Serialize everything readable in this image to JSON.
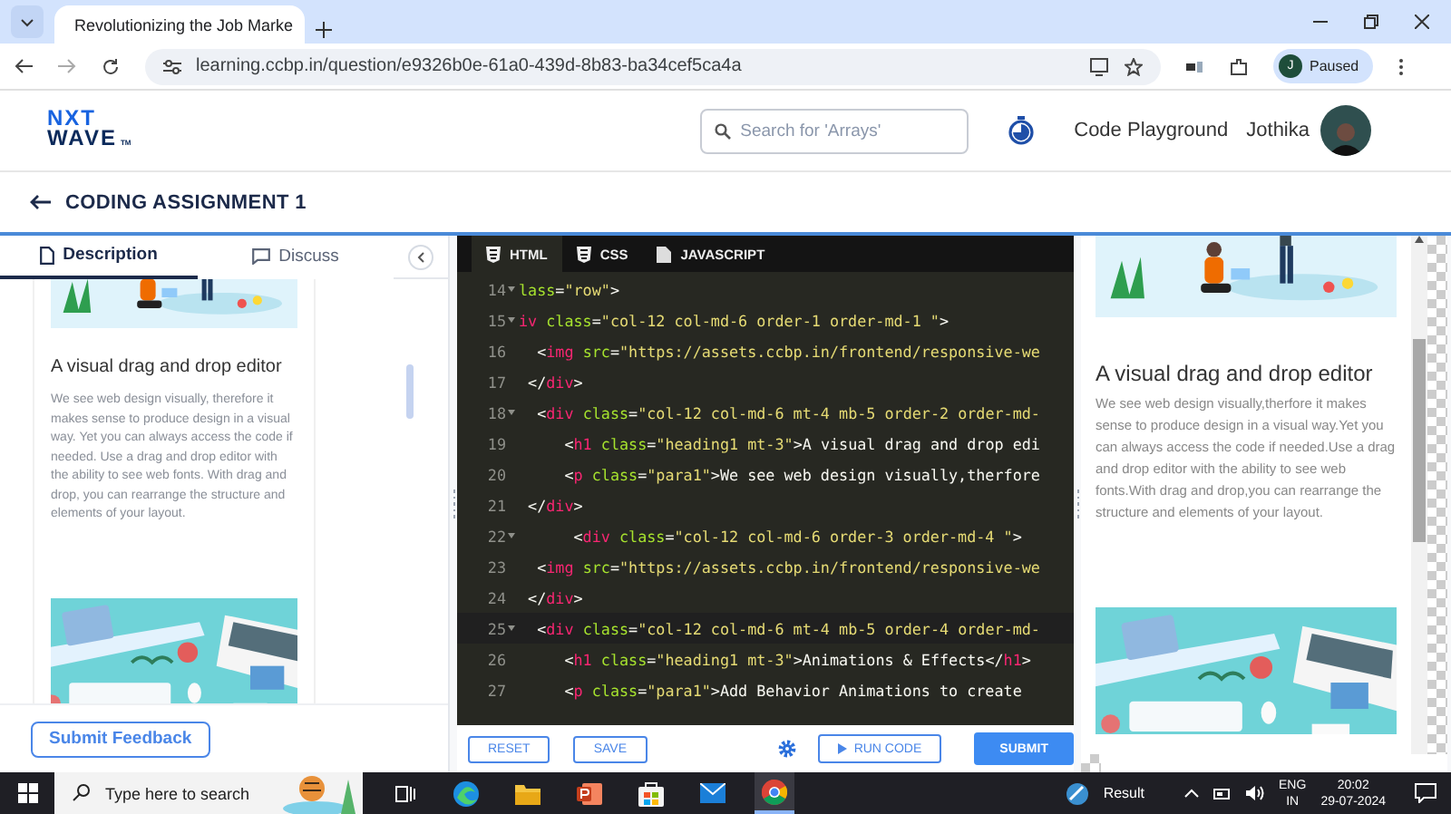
{
  "browser": {
    "tab_title": "Revolutionizing the Job Marke",
    "url": "learning.ccbp.in/question/e9326b0e-61a0-439d-8b83-ba34cef5ca4a",
    "profile_initial": "J",
    "profile_status": "Paused"
  },
  "header": {
    "logo": [
      "NXT",
      "WAVE"
    ],
    "logo_mark": "TM",
    "search": {
      "placeholder": "Search for 'Arrays'"
    },
    "nav": "Code Playground",
    "user": "Jothika"
  },
  "assignment": {
    "title": "CODING ASSIGNMENT 1"
  },
  "description": {
    "tabs": [
      {
        "label": "Description",
        "selected": true
      },
      {
        "label": "Discuss",
        "selected": false
      }
    ],
    "content": [
      {
        "kind": "picture"
      },
      {
        "kind": "heading",
        "text": "A visual drag and drop editor"
      },
      {
        "kind": "paragraph",
        "text": "We see web design visually, therefore it makes sense to produce design in a visual way. Yet you can always access the code if needed. Use a drag and drop editor with the ability to see web fonts. With drag and drop, you can rearrange the structure and elements of your layout."
      },
      {
        "kind": "picture"
      }
    ],
    "feedback_button": "Submit Feedback"
  },
  "editor": {
    "tabs": [
      {
        "label": "HTML",
        "selected": true
      },
      {
        "label": "CSS",
        "selected": false
      },
      {
        "label": "JAVASCRIPT",
        "selected": false
      }
    ],
    "lines": [
      {
        "number": "14",
        "fold": true,
        "active": false,
        "segments": [
          {
            "kind": "attr",
            "text": "lass"
          },
          {
            "kind": "punct",
            "text": "="
          },
          {
            "kind": "string",
            "text": "\"row\""
          },
          {
            "kind": "punct",
            "text": ">"
          }
        ]
      },
      {
        "number": "15",
        "fold": true,
        "active": false,
        "segments": [
          {
            "kind": "tag",
            "text": "iv"
          },
          {
            "kind": "attr",
            "text": " class"
          },
          {
            "kind": "punct",
            "text": "="
          },
          {
            "kind": "string",
            "text": "\"col-12 col-md-6 order-1 order-md-1 \""
          },
          {
            "kind": "punct",
            "text": ">"
          }
        ]
      },
      {
        "number": "16",
        "fold": false,
        "active": false,
        "segments": [
          {
            "kind": "punct",
            "text": "  <"
          },
          {
            "kind": "tag",
            "text": "img"
          },
          {
            "kind": "attr",
            "text": " src"
          },
          {
            "kind": "punct",
            "text": "="
          },
          {
            "kind": "string",
            "text": "\"https://assets.ccbp.in/frontend/responsive-we"
          }
        ]
      },
      {
        "number": "17",
        "fold": false,
        "active": false,
        "segments": [
          {
            "kind": "punct",
            "text": " </"
          },
          {
            "kind": "tag",
            "text": "div"
          },
          {
            "kind": "punct",
            "text": ">"
          }
        ]
      },
      {
        "number": "18",
        "fold": true,
        "active": false,
        "segments": [
          {
            "kind": "punct",
            "text": "  <"
          },
          {
            "kind": "tag",
            "text": "div"
          },
          {
            "kind": "attr",
            "text": " class"
          },
          {
            "kind": "punct",
            "text": "="
          },
          {
            "kind": "string",
            "text": "\"col-12 col-md-6 mt-4 mb-5 order-2 order-md-"
          }
        ]
      },
      {
        "number": "19",
        "fold": false,
        "active": false,
        "segments": [
          {
            "kind": "punct",
            "text": "     <"
          },
          {
            "kind": "tag",
            "text": "h1"
          },
          {
            "kind": "attr",
            "text": " class"
          },
          {
            "kind": "punct",
            "text": "="
          },
          {
            "kind": "string",
            "text": "\"heading1 mt-3\""
          },
          {
            "kind": "punct",
            "text": ">A visual drag and drop edi"
          }
        ]
      },
      {
        "number": "20",
        "fold": false,
        "active": false,
        "segments": [
          {
            "kind": "punct",
            "text": "     <"
          },
          {
            "kind": "tag",
            "text": "p"
          },
          {
            "kind": "attr",
            "text": " class"
          },
          {
            "kind": "punct",
            "text": "="
          },
          {
            "kind": "string",
            "text": "\"para1\""
          },
          {
            "kind": "punct",
            "text": ">We see web design visually,therfore"
          }
        ]
      },
      {
        "number": "21",
        "fold": false,
        "active": false,
        "segments": [
          {
            "kind": "punct",
            "text": " </"
          },
          {
            "kind": "tag",
            "text": "div"
          },
          {
            "kind": "punct",
            "text": ">"
          }
        ]
      },
      {
        "number": "22",
        "fold": true,
        "active": false,
        "segments": [
          {
            "kind": "punct",
            "text": "      <"
          },
          {
            "kind": "tag",
            "text": "div"
          },
          {
            "kind": "attr",
            "text": " class"
          },
          {
            "kind": "punct",
            "text": "="
          },
          {
            "kind": "string",
            "text": "\"col-12 col-md-6 order-3 order-md-4 \""
          },
          {
            "kind": "punct",
            "text": ">"
          }
        ]
      },
      {
        "number": "23",
        "fold": false,
        "active": false,
        "segments": [
          {
            "kind": "punct",
            "text": "  <"
          },
          {
            "kind": "tag",
            "text": "img"
          },
          {
            "kind": "attr",
            "text": " src"
          },
          {
            "kind": "punct",
            "text": "="
          },
          {
            "kind": "string",
            "text": "\"https://assets.ccbp.in/frontend/responsive-we"
          }
        ]
      },
      {
        "number": "24",
        "fold": false,
        "active": false,
        "segments": [
          {
            "kind": "punct",
            "text": " </"
          },
          {
            "kind": "tag",
            "text": "div"
          },
          {
            "kind": "punct",
            "text": ">"
          }
        ]
      },
      {
        "number": "25",
        "fold": true,
        "active": true,
        "segments": [
          {
            "kind": "punct",
            "text": "  <"
          },
          {
            "kind": "tag",
            "text": "div"
          },
          {
            "kind": "attr",
            "text": " class"
          },
          {
            "kind": "punct",
            "text": "="
          },
          {
            "kind": "string",
            "text": "\"col-12 col-md-6 mt-4 mb-5 order-4 order-md-"
          }
        ]
      },
      {
        "number": "26",
        "fold": false,
        "active": false,
        "segments": [
          {
            "kind": "punct",
            "text": "     <"
          },
          {
            "kind": "tag",
            "text": "h1"
          },
          {
            "kind": "attr",
            "text": " class"
          },
          {
            "kind": "punct",
            "text": "="
          },
          {
            "kind": "string",
            "text": "\"heading1 mt-3\""
          },
          {
            "kind": "punct",
            "text": ">Animations & Effects</"
          },
          {
            "kind": "tag",
            "text": "h1"
          },
          {
            "kind": "punct",
            "text": ">"
          }
        ]
      },
      {
        "number": "27",
        "fold": false,
        "active": false,
        "segments": [
          {
            "kind": "punct",
            "text": "     <"
          },
          {
            "kind": "tag",
            "text": "p"
          },
          {
            "kind": "attr",
            "text": " class"
          },
          {
            "kind": "punct",
            "text": "="
          },
          {
            "kind": "string",
            "text": "\"para1\""
          },
          {
            "kind": "punct",
            "text": ">Add Behavior Animations to create"
          }
        ]
      }
    ],
    "buttons": [
      {
        "label": "RESET",
        "kind": "outline"
      },
      {
        "label": "SAVE",
        "kind": "outline"
      },
      {
        "kind": "settings"
      },
      {
        "label": "RUN CODE",
        "kind": "run"
      },
      {
        "label": "SUBMIT",
        "kind": "primary"
      }
    ]
  },
  "preview": {
    "content": [
      {
        "kind": "picture"
      },
      {
        "kind": "heading",
        "text": "A visual drag and drop editor"
      },
      {
        "kind": "paragraph",
        "text": "We see web design visually,therfore it makes sense to produce design in a visual way.Yet you can always access the code if needed.Use a drag and drop editor with the ability to see web fonts.With drag and drop,you can rearrange the structure and elements of your layout."
      },
      {
        "kind": "picture"
      }
    ]
  },
  "taskbar": {
    "search": {
      "placeholder": "Type here to search"
    },
    "weather": "Result",
    "language": [
      "ENG",
      "IN"
    ],
    "time": "20:02",
    "date": "29-07-2024"
  }
}
